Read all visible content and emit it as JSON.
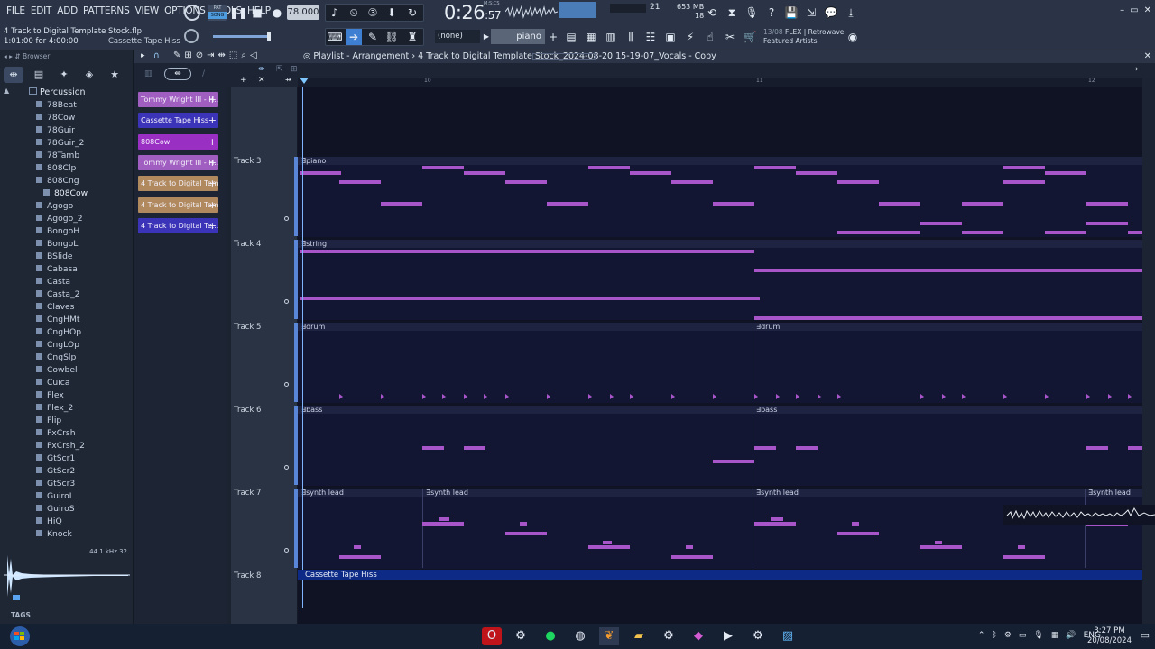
{
  "menu": [
    "FILE",
    "EDIT",
    "ADD",
    "PATTERNS",
    "VIEW",
    "OPTIONS",
    "TOOLS",
    "HELP"
  ],
  "song_info": {
    "file": "4 Track to Digital Template Stock.flp",
    "position": "1:01:00 for 4:00:00",
    "hint": "Cassette Tape Hiss"
  },
  "transport": {
    "mode_pat": "PAT",
    "mode_song": "SONG",
    "tempo": "78.000",
    "time_main": "0:26",
    "time_sub": ":57",
    "time_unit": "M:S:CS"
  },
  "cpu": {
    "voices": "21",
    "ram": "653 MB",
    "poly": "18"
  },
  "pattern_selector": "(none)",
  "instrument_box": "piano",
  "news": {
    "count": "13/08",
    "line1": "FLEX | Retrowave",
    "line2": "Featured Artists"
  },
  "window_controls": [
    "–",
    "▭",
    "✕"
  ],
  "browser": {
    "title": "Browser",
    "folder": "Percussion",
    "items": [
      "78Beat",
      "78Cow",
      "78Guir",
      "78Guir_2",
      "78Tamb",
      "808Clp",
      "808Cng",
      "808Cow",
      "Agogo",
      "Agogo_2",
      "BongoH",
      "BongoL",
      "BSlide",
      "Cabasa",
      "Casta",
      "Casta_2",
      "Claves",
      "CngHMt",
      "CngHOp",
      "CngLOp",
      "CngSlp",
      "Cowbel",
      "Cuica",
      "Flex",
      "Flex_2",
      "Flip",
      "FxCrsh",
      "FxCrsh_2",
      "GtScr1",
      "GtScr2",
      "GtScr3",
      "GuiroL",
      "GuiroS",
      "HiQ",
      "Knock"
    ],
    "sample_rate": "44.1 kHz 32",
    "tags": "TAGS"
  },
  "playlist": {
    "title": "Playlist - Arrangement",
    "breadcrumb_sep": "›",
    "project": "4 Track to Digital Template Stock_2024-08-20 15-19-07_Vocals - Copy",
    "ruler": [
      "10",
      "11",
      "12"
    ]
  },
  "patterns": [
    {
      "name": "Tommy Wright III - H...",
      "color": "#a05fc0"
    },
    {
      "name": "Cassette Tape Hiss",
      "color": "#3b34b8"
    },
    {
      "name": "808Cow",
      "color": "#9a2fc4"
    },
    {
      "name": "Tommy Wright III - H...",
      "color": "#a05fc0"
    },
    {
      "name": "4 Track to Digital Templat...",
      "color": "#b08a5e"
    },
    {
      "name": "4 Track to Digital Templat...",
      "color": "#b08a5e"
    },
    {
      "name": "4 Track to Digital Te...",
      "color": "#3b34b8"
    }
  ],
  "tracks": [
    {
      "name": "Track 3",
      "clips": [
        "piano"
      ]
    },
    {
      "name": "Track 4",
      "clips": [
        "string"
      ]
    },
    {
      "name": "Track 5",
      "clips": [
        "drum",
        "drum"
      ]
    },
    {
      "name": "Track 6",
      "clips": [
        "bass",
        "bass"
      ]
    },
    {
      "name": "Track 7",
      "clips": [
        "synth lead",
        "synth lead",
        "synth lead",
        "synth lead"
      ]
    },
    {
      "name": "Track 8",
      "clips": [
        "Cassette Tape Hiss"
      ]
    }
  ],
  "taskbar": {
    "tray_lang": "ENG",
    "clock_time": "3:27 PM",
    "clock_date": "20/08/2024"
  }
}
